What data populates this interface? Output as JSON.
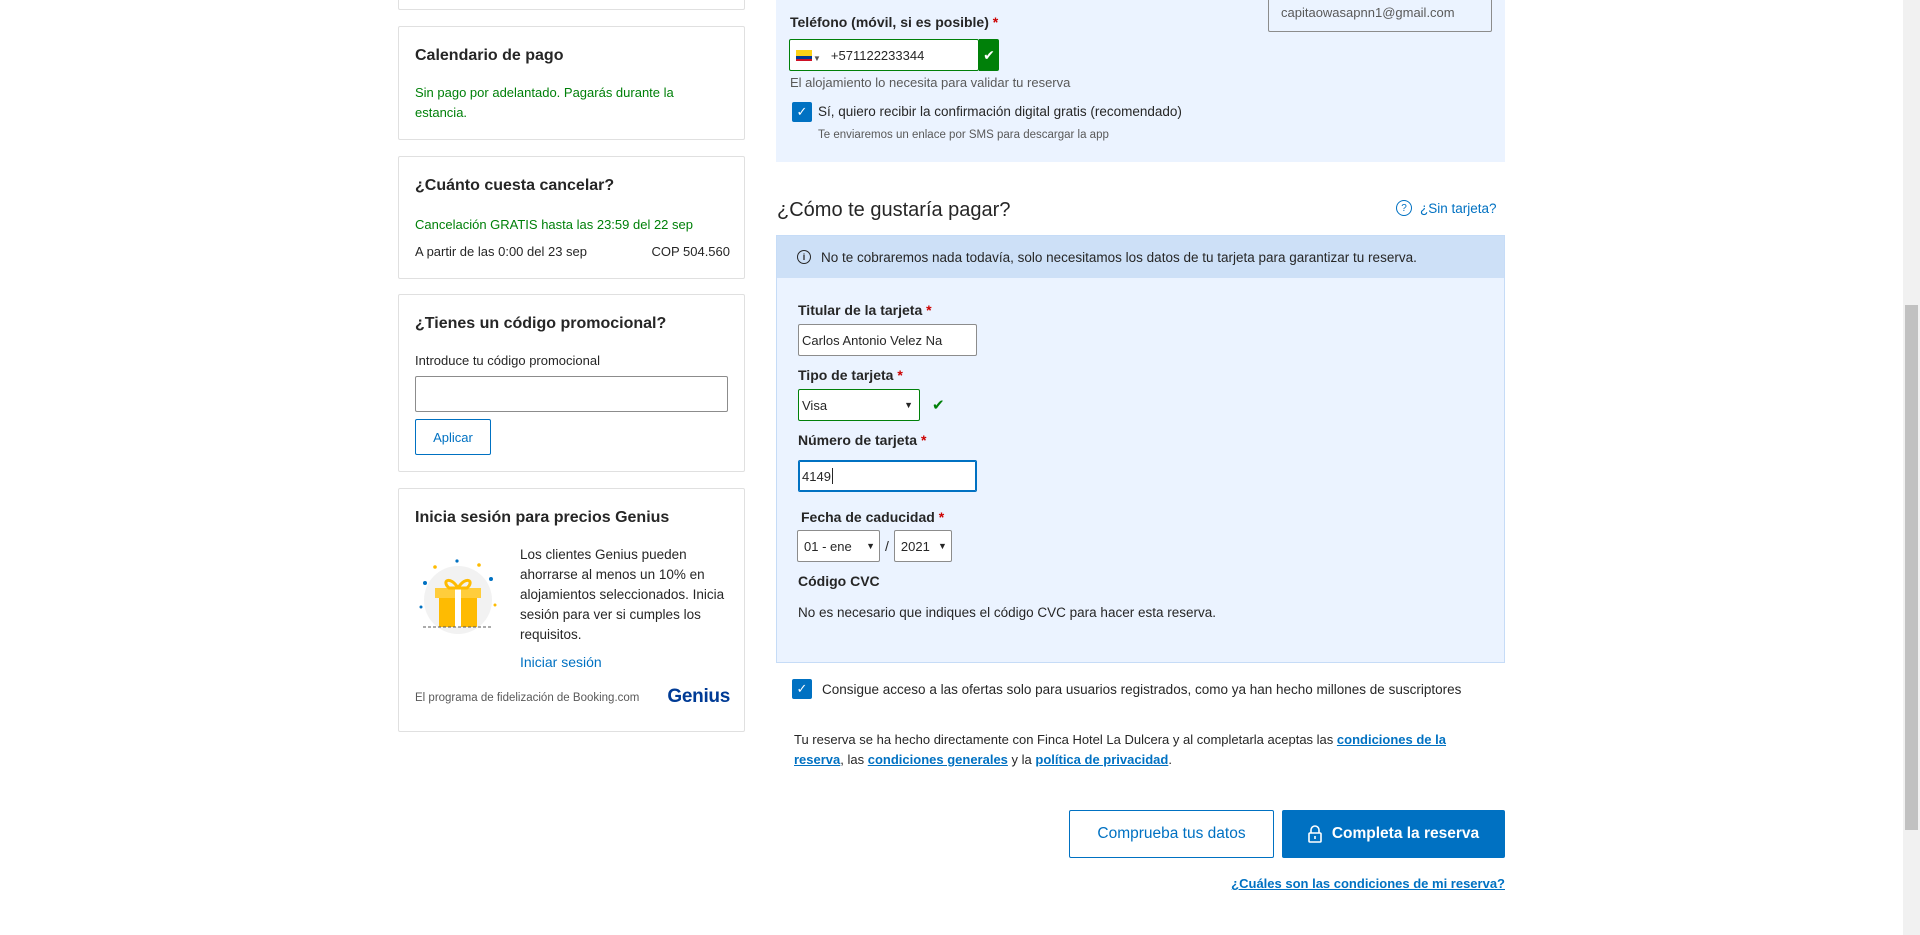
{
  "sidebar": {
    "payment": {
      "title": "Calendario de pago",
      "text": "Sin pago por adelantado. Pagarás durante la estancia."
    },
    "cancel": {
      "title": "¿Cuánto cuesta cancelar?",
      "free": "Cancelación GRATIS hasta las 23:59 del 22 sep",
      "from": "A partir de las 0:00 del 23 sep",
      "amount": "COP 504.560"
    },
    "promo": {
      "title": "¿Tienes un código promocional?",
      "label": "Introduce tu código promocional",
      "value": "",
      "apply": "Aplicar"
    },
    "genius": {
      "title": "Inicia sesión para precios Genius",
      "text": "Los clientes Genius pueden ahorrarse al menos un 10% en alojamientos seleccionados. Inicia sesión para ver si cumples los requisitos.",
      "link": "Iniciar sesión",
      "footer": "El programa de fidelización de Booking.com",
      "logo": "Genius"
    }
  },
  "contact": {
    "email": "capitaowasapnn1@gmail.com",
    "phone_label": "Teléfono (móvil, si es posible)",
    "required_mark": "*",
    "phone_value": "+571122233344",
    "phone_help": "El alojamiento lo necesita para validar tu reserva",
    "sms_checkbox": "Sí, quiero recibir la confirmación digital gratis (recomendado)",
    "sms_sub": "Te enviaremos un enlace por SMS para descargar la app"
  },
  "payment": {
    "title": "¿Cómo te gustaría pagar?",
    "no_card": "¿Sin tarjeta?",
    "info": "No te cobraremos nada todavía, solo necesitamos los datos de tu tarjeta para garantizar tu reserva.",
    "holder_label": "Titular de la tarjeta",
    "holder_value": "Carlos Antonio Velez Na",
    "type_label": "Tipo de tarjeta",
    "type_value": "Visa",
    "number_label": "Número de tarjeta",
    "number_value": "4149",
    "expiry_label": "Fecha de caducidad",
    "month_value": "01 - ene",
    "separator": "/",
    "year_value": "2021",
    "cvc_label": "Código CVC",
    "cvc_text": "No es necesario que indiques el código CVC para hacer esta reserva."
  },
  "offers_checkbox": "Consigue acceso a las ofertas solo para usuarios registrados, como ya han hecho millones de suscriptores",
  "terms": {
    "prefix": "Tu reserva se ha hecho directamente con Finca Hotel La Dulcera y al completarla aceptas las ",
    "link1": "condiciones de la reserva",
    "mid1": ", las ",
    "link2": "condiciones generales",
    "mid2": " y la ",
    "link3": "política de privacidad",
    "suffix": "."
  },
  "actions": {
    "check": "Comprueba tus datos",
    "book": "Completa la reserva",
    "conditions_link": "¿Cuáles son las condiciones de mi reserva?"
  },
  "colors": {
    "primary": "#0071c2",
    "success": "#008009",
    "panel": "#ebf3ff",
    "info_bar": "#cde0f7",
    "genius": "#003b95"
  },
  "icons": [
    "colombia-flag-icon",
    "check-icon",
    "question-icon",
    "info-icon",
    "gift-icon",
    "lock-icon",
    "chevron-down-icon"
  ]
}
